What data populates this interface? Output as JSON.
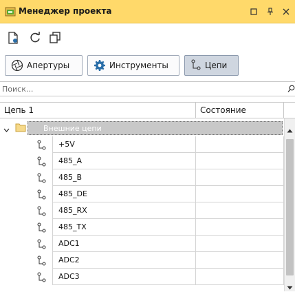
{
  "window": {
    "title": "Менеджер проекта",
    "controls": {
      "maximize_icon": "maximize-icon",
      "pin_icon": "pin-icon",
      "close_icon": "close-icon"
    }
  },
  "toolbar": {
    "icons": [
      "new-document-icon",
      "refresh-icon",
      "copy-icon"
    ]
  },
  "tabs": [
    {
      "label": "Апертуры",
      "icon": "aperture-icon",
      "active": false
    },
    {
      "label": "Инструменты",
      "icon": "gear-icon",
      "active": false
    },
    {
      "label": "Цепи",
      "icon": "net-icon",
      "active": true
    }
  ],
  "search": {
    "placeholder": "Поиск...",
    "value": ""
  },
  "table": {
    "columns": [
      "Цепь 1",
      "Состояние"
    ],
    "group": {
      "label": "Внешние цепи",
      "expanded": true
    },
    "rows": [
      {
        "name": "+5V",
        "state": ""
      },
      {
        "name": "485_A",
        "state": ""
      },
      {
        "name": "485_B",
        "state": ""
      },
      {
        "name": "485_DE",
        "state": ""
      },
      {
        "name": "485_RX",
        "state": ""
      },
      {
        "name": "485_TX",
        "state": ""
      },
      {
        "name": "ADC1",
        "state": ""
      },
      {
        "name": "ADC2",
        "state": ""
      },
      {
        "name": "ADC3",
        "state": ""
      }
    ]
  },
  "colors": {
    "title_bar": "#ffd96a",
    "active_tab": "#cfd6e0",
    "group_highlight": "#c8c8c8",
    "icon_accent": "#2a6ea8"
  }
}
